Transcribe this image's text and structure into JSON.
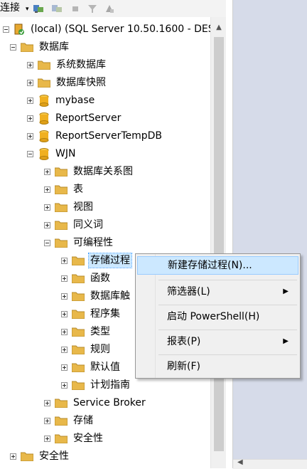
{
  "toolbar": {
    "connect_label": "连接",
    "dropdown_arrow": "▾"
  },
  "tree": {
    "server": "(local) (SQL Server 10.50.1600 - DES",
    "databases": "数据库",
    "system_db": "系统数据库",
    "snapshots": "数据库快照",
    "db_mybase": "mybase",
    "db_report": "ReportServer",
    "db_reporttemp": "ReportServerTempDB",
    "db_wjn": "WJN",
    "wjn_diagrams": "数据库关系图",
    "wjn_tables": "表",
    "wjn_views": "视图",
    "wjn_synonyms": "同义词",
    "wjn_programmability": "可编程性",
    "prog_sp": "存储过程",
    "prog_functions": "函数",
    "prog_triggers": "数据库触",
    "prog_assemblies": "程序集",
    "prog_types": "类型",
    "prog_rules": "规则",
    "prog_defaults": "默认值",
    "prog_plan_guides": "计划指南",
    "wjn_service_broker": "Service Broker",
    "wjn_storage": "存储",
    "wjn_security": "安全性",
    "server_security": "安全性"
  },
  "context_menu": {
    "new_sp": "新建存储过程(N)...",
    "filter": "筛选器(L)",
    "powershell": "启动 PowerShell(H)",
    "reports": "报表(P)",
    "refresh": "刷新(F)",
    "submenu_arrow": "▶"
  },
  "scroll": {
    "up_arrow": "▲",
    "left_arrow": "◀"
  },
  "colors": {
    "selection": "#cce8ff",
    "folder": "#e8b84a",
    "db_cylinder": "#f0b020"
  }
}
